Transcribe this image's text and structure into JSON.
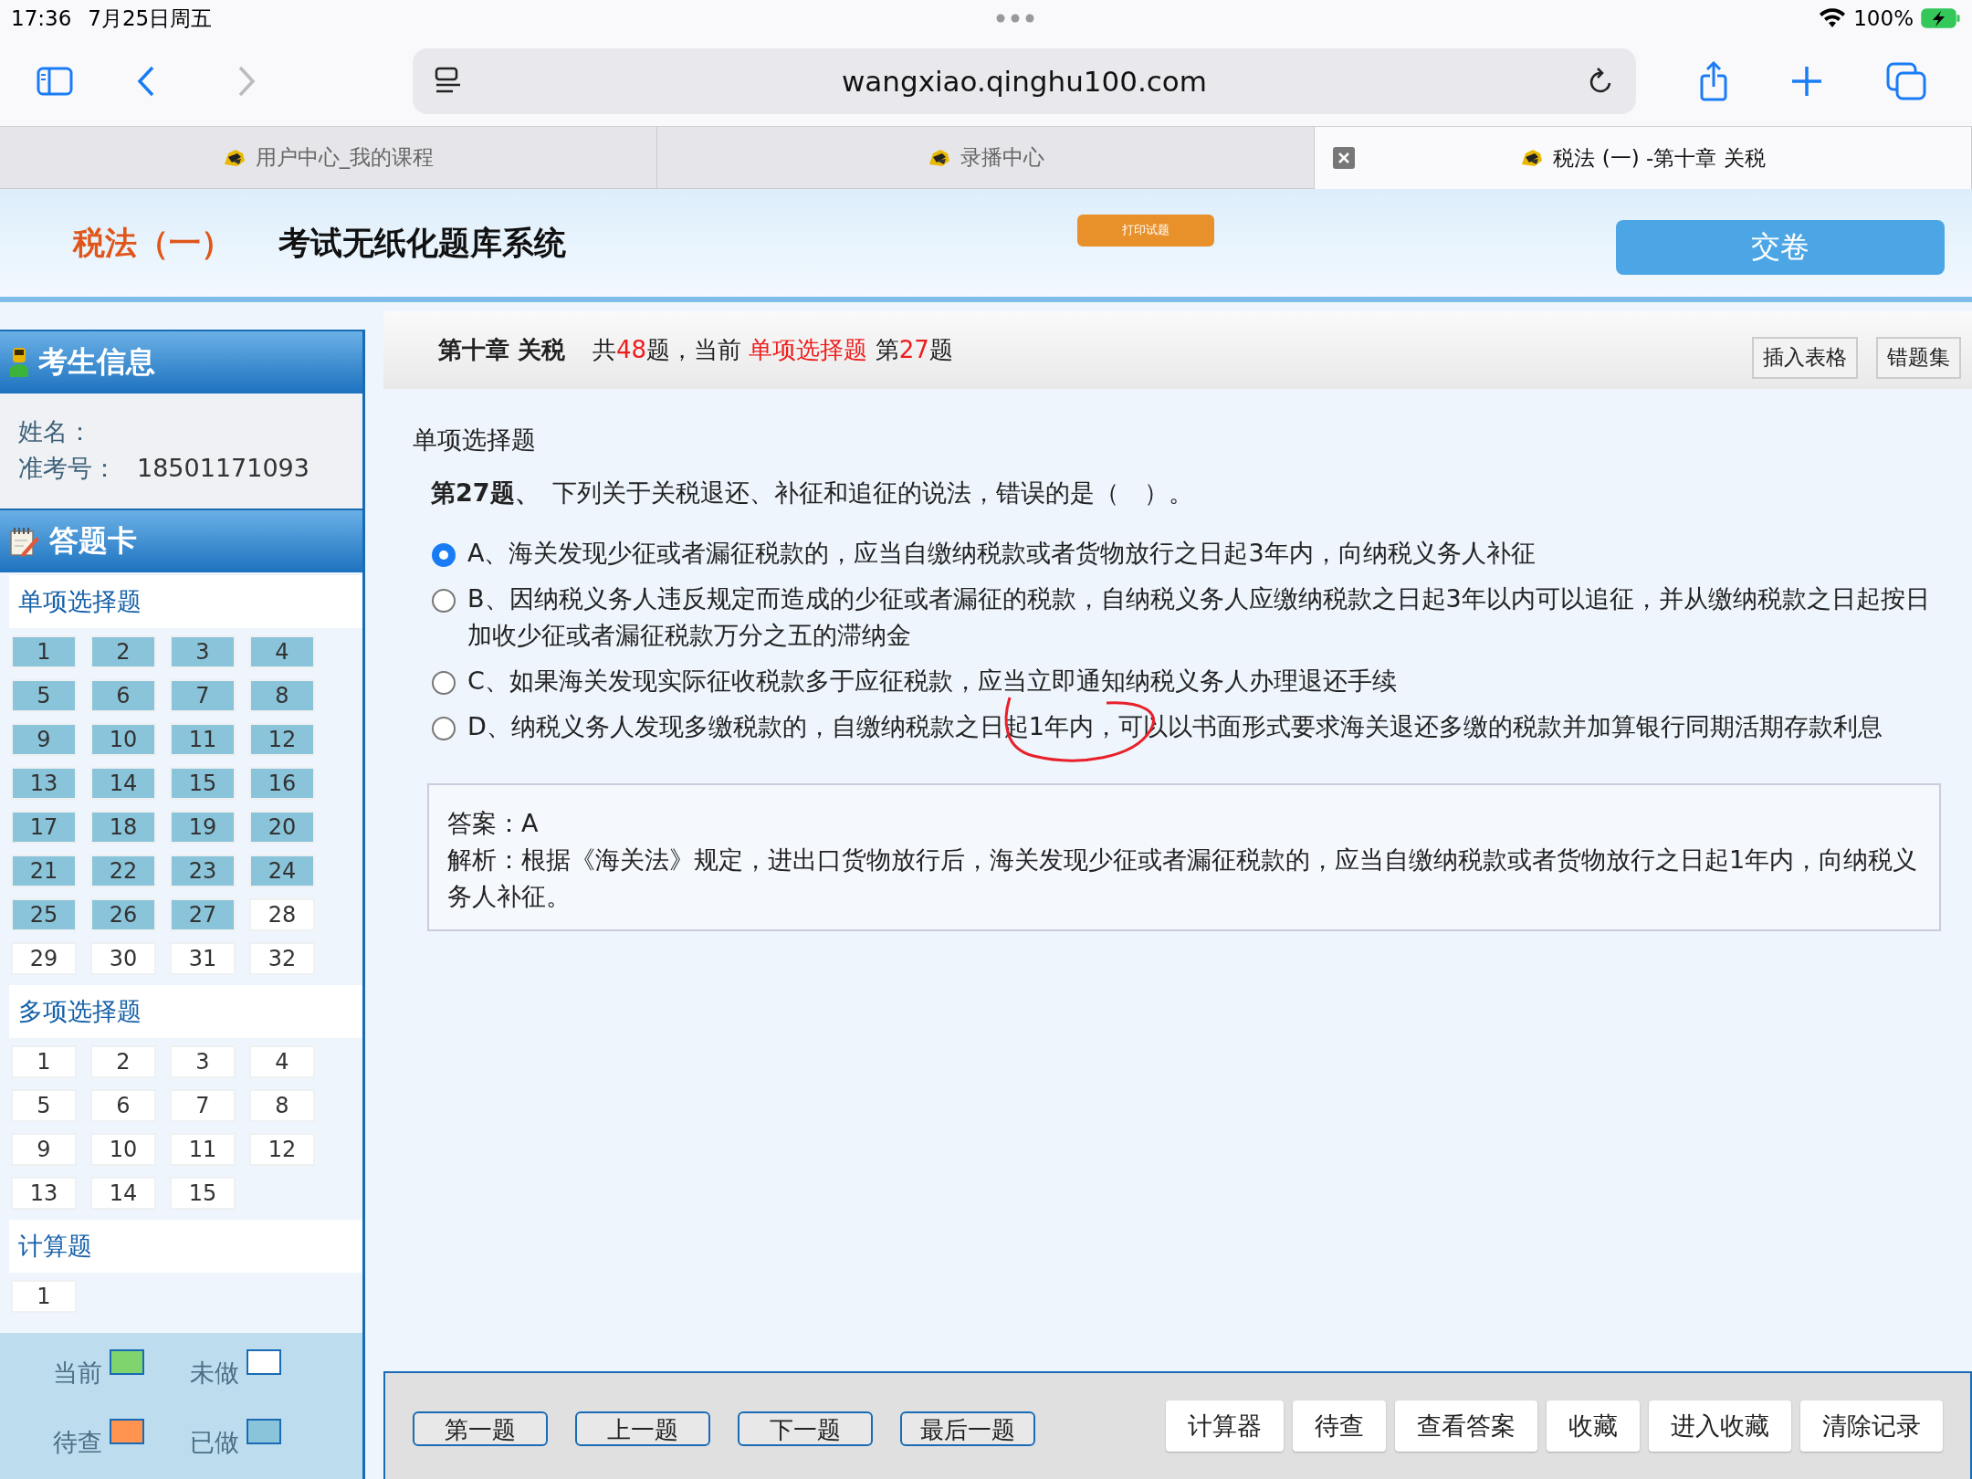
{
  "status_bar": {
    "time": "17:36",
    "date": "7月25日周五",
    "battery": "100%"
  },
  "browser": {
    "url": "wangxiao.qinghu100.com",
    "tabs": [
      {
        "title": "用户中心_我的课程",
        "selected": false
      },
      {
        "title": "录播中心",
        "selected": false
      },
      {
        "title": "税法 (一) -第十章 关税",
        "selected": true
      }
    ]
  },
  "header": {
    "subject": "税法（一）",
    "system_title": "考试无纸化题库系统",
    "print_button": "打印试题",
    "submit_button": "交卷"
  },
  "sidebar": {
    "info_title": "考生信息",
    "name_label": "姓名：",
    "id_label": "准考号：",
    "id_value": "18501171093",
    "card_title": "答题卡",
    "sections": [
      {
        "title": "单项选择题",
        "items": [
          {
            "label": "1",
            "answered": true
          },
          {
            "label": "2",
            "answered": true
          },
          {
            "label": "3",
            "answered": true
          },
          {
            "label": "4",
            "answered": true
          },
          {
            "label": "5",
            "answered": true
          },
          {
            "label": "6",
            "answered": true
          },
          {
            "label": "7",
            "answered": true
          },
          {
            "label": "8",
            "answered": true
          },
          {
            "label": "9",
            "answered": true
          },
          {
            "label": "10",
            "answered": true
          },
          {
            "label": "11",
            "answered": true
          },
          {
            "label": "12",
            "answered": true
          },
          {
            "label": "13",
            "answered": true
          },
          {
            "label": "14",
            "answered": true
          },
          {
            "label": "15",
            "answered": true
          },
          {
            "label": "16",
            "answered": true
          },
          {
            "label": "17",
            "answered": true
          },
          {
            "label": "18",
            "answered": true
          },
          {
            "label": "19",
            "answered": true
          },
          {
            "label": "20",
            "answered": true
          },
          {
            "label": "21",
            "answered": true
          },
          {
            "label": "22",
            "answered": true
          },
          {
            "label": "23",
            "answered": true
          },
          {
            "label": "24",
            "answered": true
          },
          {
            "label": "25",
            "answered": true
          },
          {
            "label": "26",
            "answered": true
          },
          {
            "label": "27",
            "answered": true
          },
          {
            "label": "28",
            "answered": false
          },
          {
            "label": "29",
            "answered": false
          },
          {
            "label": "30",
            "answered": false
          },
          {
            "label": "31",
            "answered": false
          },
          {
            "label": "32",
            "answered": false
          }
        ]
      },
      {
        "title": "多项选择题",
        "items": [
          {
            "label": "1",
            "answered": false
          },
          {
            "label": "2",
            "answered": false
          },
          {
            "label": "3",
            "answered": false
          },
          {
            "label": "4",
            "answered": false
          },
          {
            "label": "5",
            "answered": false
          },
          {
            "label": "6",
            "answered": false
          },
          {
            "label": "7",
            "answered": false
          },
          {
            "label": "8",
            "answered": false
          },
          {
            "label": "9",
            "answered": false
          },
          {
            "label": "10",
            "answered": false
          },
          {
            "label": "11",
            "answered": false
          },
          {
            "label": "12",
            "answered": false
          },
          {
            "label": "13",
            "answered": false
          },
          {
            "label": "14",
            "answered": false
          },
          {
            "label": "15",
            "answered": false
          }
        ]
      },
      {
        "title": "计算题",
        "items": [
          {
            "label": "1",
            "answered": false
          }
        ]
      }
    ],
    "legend": [
      {
        "label": "当前",
        "color": "#80d46e"
      },
      {
        "label": "未做",
        "color": "#ffffff"
      },
      {
        "label": "待查",
        "color": "#ff9450"
      },
      {
        "label": "已做",
        "color": "#8ac4da"
      }
    ]
  },
  "question_bar": {
    "chapter": "第十章 关税",
    "summary": [
      {
        "text": "共",
        "highlight": false
      },
      {
        "text": "48",
        "highlight": true
      },
      {
        "text": "题，当前 ",
        "highlight": false
      },
      {
        "text": "单项选择题",
        "highlight": true
      },
      {
        "text": " 第",
        "highlight": false
      },
      {
        "text": "27",
        "highlight": true
      },
      {
        "text": "题",
        "highlight": false
      }
    ],
    "buttons": [
      "插入表格",
      "错题集"
    ]
  },
  "question": {
    "type_label": "单项选择题",
    "number": "第27题、",
    "stem": "下列关于关税退还、补征和追征的说法，错误的是（　）。",
    "options": [
      {
        "text": "A、海关发现少征或者漏征税款的，应当自缴纳税款或者货物放行之日起3年内，向纳税义务人补征",
        "selected": true
      },
      {
        "text": "B、因纳税义务人违反规定而造成的少征或者漏征的税款，自纳税义务人应缴纳税款之日起3年以内可以追征，并从缴纳税款之日起按日加收少征或者漏征税款万分之五的滞纳金",
        "selected": false
      },
      {
        "text": "C、如果海关发现实际征收税款多于应征税款，应当立即通知纳税义务人办理退还手续",
        "selected": false
      },
      {
        "text": "D、纳税义务人发现多缴税款的，自缴纳税款之日起1年内，可以以书面形式要求海关退还多缴的税款并加算银行同期活期存款利息",
        "selected": false
      }
    ]
  },
  "answer": {
    "answer_line": "答案：A",
    "analysis": "解析：根据《海关法》规定，进出口货物放行后，海关发现少征或者漏征税款的，应当自缴纳税款或者货物放行之日起1年内，向纳税义务人补征。"
  },
  "footer": {
    "nav_buttons": [
      "第一题",
      "上一题",
      "下一题",
      "最后一题"
    ],
    "tool_buttons": [
      "计算器",
      "待查",
      "查看答案",
      "收藏",
      "进入收藏",
      "清除记录"
    ]
  }
}
